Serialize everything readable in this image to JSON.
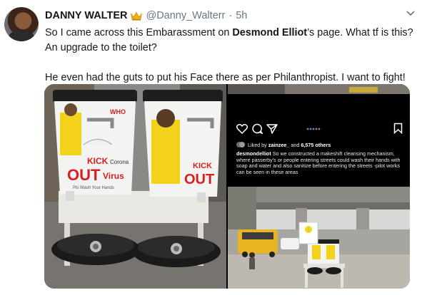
{
  "tweet": {
    "author_name": "DANNY WALTER",
    "author_handle": "@Danny_Walterr",
    "separator": "·",
    "timestamp": "5h",
    "text_part1": "So I came across this Embarassment on ",
    "mention": "Desmond Elliot",
    "text_part2": "’s page. What tf is this? An upgrade to the toilet?",
    "paragraph2": "He even had the guts to put his Face there as per Philanthropist. I want to fight!"
  },
  "photo_left": {
    "bucket_text": [
      "WHO",
      "KICK",
      "Corona",
      "OUT",
      "Virus",
      "Pls Wash Your Hands"
    ]
  },
  "instagram": {
    "liked_by_prefix": "Liked by ",
    "liked_by_user": "zainzee_",
    "liked_by_middle": " and ",
    "liked_by_count": "6,575 others",
    "caption_user": "desmondelliot",
    "caption_text": " So we constructed a makeshift cleansing mechanism, where passerby's or people entering streets could wash their hands with soap and water and also sanitize before entering the streets -pilot works can be seen in these areas"
  },
  "colors": {
    "text_primary": "#14171a",
    "text_secondary": "#657786",
    "accent_red": "#d62020",
    "bucket_yellow": "#f2d21b"
  },
  "icons": [
    "crown-icon",
    "chevron-down-icon",
    "heart-icon",
    "comment-icon",
    "send-icon",
    "bookmark-icon"
  ]
}
